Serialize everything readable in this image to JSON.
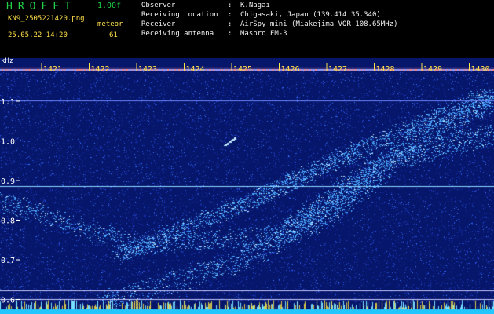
{
  "app": {
    "title": "HROFFT",
    "version": "1.00f"
  },
  "file": {
    "name": "KN9_2505221420.png",
    "datetime": "25.05.22 14:20"
  },
  "mode": {
    "label": "meteor",
    "count": "61"
  },
  "metadata": [
    {
      "key": "Observer",
      "value": "K.Nagai"
    },
    {
      "key": "Receiving Location",
      "value": "Chigasaki, Japan (139.414 35.340)"
    },
    {
      "key": "Receiver",
      "value": "AirSpy mini (Miakejima VOR 108.65MHz)"
    },
    {
      "key": "Receiving antenna",
      "value": "Maspro FM-3"
    }
  ],
  "axis": {
    "unit": "kHz",
    "y_ticks": [
      "1.1",
      "1.0",
      "0.9",
      "0.8",
      "0.7",
      "0.6"
    ],
    "y_tick_values": [
      1.1,
      1.0,
      0.9,
      0.8,
      0.7,
      0.6
    ],
    "x_ticks": [
      "1421",
      "1422",
      "1423",
      "1424",
      "1425",
      "1426",
      "1427",
      "1428",
      "1429",
      "1430"
    ]
  },
  "colors": {
    "background": "#06166a",
    "noise": "#2a52e6",
    "signal": "#4aa6ff",
    "hot": "#bfe8ff",
    "carrier": "#ff5a5a",
    "bottom_band": "#24c6ff",
    "ticks": "#ffe14a",
    "header_green": "#22d24a"
  }
}
